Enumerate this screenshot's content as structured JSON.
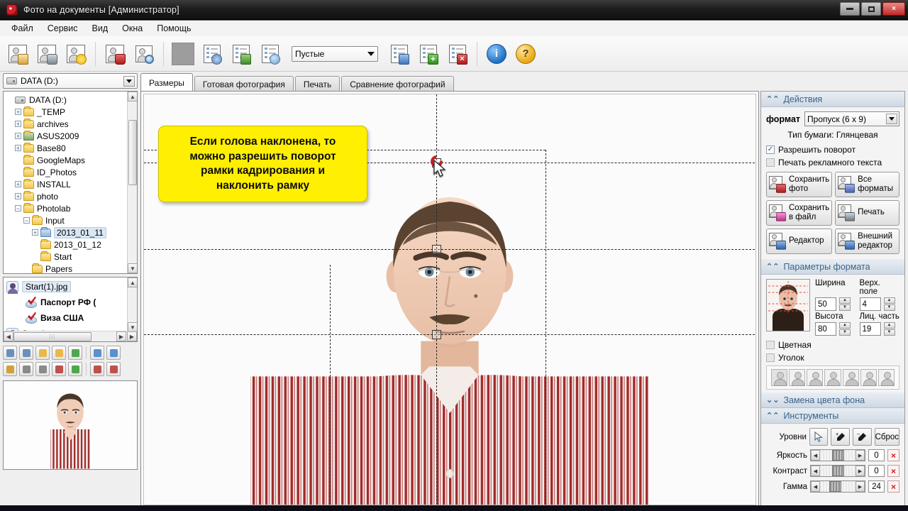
{
  "window": {
    "title": "Фото на документы  [Администратор]",
    "icon": "camera-icon",
    "controls": {
      "minimize": "minimize-icon",
      "maximize": "maximize-icon",
      "close": "×"
    }
  },
  "menu": {
    "items": [
      "Файл",
      "Сервис",
      "Вид",
      "Окна",
      "Помощь"
    ]
  },
  "toolbar": {
    "buttons": [
      {
        "name": "open-photo-button",
        "icon": "person-folder-icon"
      },
      {
        "name": "capture-photo-button",
        "icon": "person-camera-icon"
      },
      {
        "name": "new-photo-button",
        "icon": "person-star-icon"
      },
      {
        "name": "delete-photo-button",
        "icon": "person-trash-icon"
      },
      {
        "name": "find-photo-button",
        "icon": "person-search-icon"
      }
    ],
    "color_swatch": "#9d9d9d",
    "templates_combo": {
      "value": "Пустые",
      "placeholder": "Пустые"
    },
    "list_buttons": [
      {
        "name": "apply-template-button",
        "icon": "list-arrow-icon"
      },
      {
        "name": "add-template-button",
        "icon": "list-plus-icon"
      },
      {
        "name": "remove-template-button",
        "icon": "list-delete-icon"
      }
    ],
    "info_button": {
      "label": "i",
      "name": "info-button"
    },
    "help_button": {
      "label": "?",
      "name": "help-button"
    }
  },
  "sidebar": {
    "drive_combo": {
      "value": "DATA (D:)"
    },
    "tree": [
      {
        "label": "DATA (D:)",
        "indent": 0,
        "expander": "",
        "icon": "drive-icon"
      },
      {
        "label": "_TEMP",
        "indent": 1,
        "expander": "+",
        "icon": "folder-icon"
      },
      {
        "label": "archives",
        "indent": 1,
        "expander": "+",
        "icon": "folder-icon"
      },
      {
        "label": "ASUS2009",
        "indent": 1,
        "expander": "+",
        "icon": "folder-shortcut-icon"
      },
      {
        "label": "Base80",
        "indent": 1,
        "expander": "+",
        "icon": "folder-icon"
      },
      {
        "label": "GoogleMaps",
        "indent": 1,
        "expander": "",
        "icon": "folder-icon"
      },
      {
        "label": "ID_Photos",
        "indent": 1,
        "expander": "",
        "icon": "folder-icon"
      },
      {
        "label": "INSTALL",
        "indent": 1,
        "expander": "+",
        "icon": "folder-icon"
      },
      {
        "label": "photo",
        "indent": 1,
        "expander": "+",
        "icon": "folder-icon"
      },
      {
        "label": "Photolab",
        "indent": 1,
        "expander": "−",
        "icon": "folder-icon"
      },
      {
        "label": "Input",
        "indent": 2,
        "expander": "−",
        "icon": "folder-icon"
      },
      {
        "label": "2013_01_11",
        "indent": 3,
        "expander": "+",
        "icon": "folder-open-icon",
        "selected": true
      },
      {
        "label": "2013_01_12",
        "indent": 3,
        "expander": "",
        "icon": "folder-icon"
      },
      {
        "label": "Start",
        "indent": 3,
        "expander": "",
        "icon": "folder-icon"
      },
      {
        "label": "Papers",
        "indent": 2,
        "expander": "",
        "icon": "folder-icon"
      }
    ],
    "files": [
      {
        "label": "Start(1).jpg",
        "icon": "person-photo-icon",
        "selected": true,
        "child": false
      },
      {
        "label": "Паспорт РФ (",
        "icon": "check-format-icon",
        "selected": false,
        "child": true
      },
      {
        "label": "Виза США",
        "icon": "check-format-icon",
        "selected": false,
        "child": true
      },
      {
        "label": "Start.jpg",
        "icon": "person-photo-icon",
        "selected": false,
        "child": false
      }
    ],
    "hscroll_grip": "⦙⦙⦙",
    "minitools_row1": [
      {
        "name": "add-format-button",
        "icon": "add-format-icon"
      },
      {
        "name": "remove-format-button",
        "icon": "remove-format-icon"
      },
      {
        "name": "open-folder-button",
        "icon": "folder-up-icon"
      },
      {
        "name": "folder-props-button",
        "icon": "folder-window-icon"
      },
      {
        "name": "refresh-folder-button",
        "icon": "refresh-icon"
      },
      {
        "name": "sort-name-asc-button",
        "icon": "sort-az-down-icon"
      },
      {
        "name": "sort-date-asc-button",
        "icon": "sort-date-down-icon"
      }
    ],
    "minitools_row2": [
      {
        "name": "edit-button",
        "icon": "pencil-icon"
      },
      {
        "name": "rotate-left-button",
        "icon": "rotate-left-icon"
      },
      {
        "name": "rotate-right-button",
        "icon": "rotate-right-icon"
      },
      {
        "name": "delete-file-button",
        "icon": "delete-file-icon"
      },
      {
        "name": "swap-button",
        "icon": "swap-icon"
      },
      {
        "name": "sort-name-desc-button",
        "icon": "sort-az-up-icon"
      },
      {
        "name": "sort-date-desc-button",
        "icon": "sort-date-up-icon"
      }
    ]
  },
  "tabs": [
    {
      "label": "Размеры",
      "active": true
    },
    {
      "label": "Готовая фотография",
      "active": false
    },
    {
      "label": "Печать",
      "active": false
    },
    {
      "label": "Сравнение фотографий",
      "active": false
    }
  ],
  "callout": {
    "lines": [
      "Если голова наклонена, то",
      "можно разрешить поворот",
      "рамки кадрирования и",
      "наклонить рамку"
    ],
    "background": "#ffef00",
    "text_color": "#0d0d0d"
  },
  "canvas": {
    "rotate_handle": "rotate-handle",
    "cursor": "arrow-cursor",
    "handle_color": "#cf1f22"
  },
  "right_panel": {
    "actions": {
      "title": "Действия",
      "format_label": "формат",
      "format_value": "Пропуск (6 x 9)",
      "paper_type_label": "Тип бумаги:",
      "paper_type_value": "Глянцевая",
      "allow_rotation": {
        "label": "Разрешить поворот",
        "checked": true
      },
      "print_ad_text": {
        "label": "Печать рекламного текста",
        "checked": false
      },
      "buttons": [
        {
          "label": "Сохранить\nфото",
          "name": "save-photo-button",
          "icon": "save-photo-icon"
        },
        {
          "label": "Все\nформаты",
          "name": "all-formats-button",
          "icon": "all-formats-icon"
        },
        {
          "label": "Сохранить\nв файл",
          "name": "save-to-file-button",
          "icon": "save-file-icon"
        },
        {
          "label": "Печать",
          "name": "print-button",
          "icon": "printer-icon"
        },
        {
          "label": "Редактор",
          "name": "editor-button",
          "icon": "editor-icon"
        },
        {
          "label": "Внешний\nредактор",
          "name": "external-editor-button",
          "icon": "external-editor-icon"
        }
      ]
    },
    "format_params": {
      "title": "Параметры формата",
      "fields": [
        {
          "label": "Ширина",
          "value": "50",
          "name": "width-field"
        },
        {
          "label": "Верх. поле",
          "value": "4",
          "name": "top-margin-field"
        },
        {
          "label": "Высота",
          "value": "80",
          "name": "height-field"
        },
        {
          "label": "Лиц. часть",
          "value": "19",
          "name": "face-part-field"
        }
      ],
      "color_checkbox": {
        "label": "Цветная",
        "checked": false
      },
      "corner_checkbox": {
        "label": "Уголок",
        "checked": false
      },
      "pose_count": 7
    },
    "background_replace": {
      "title": "Замена цвета фона",
      "collapsed": true
    },
    "tools": {
      "title": "Инструменты",
      "levels_label": "Уровни",
      "reset_label": "Сброс",
      "level_buttons": [
        {
          "name": "pointer-tool-button",
          "icon": "pointer-icon"
        },
        {
          "name": "white-point-picker-button",
          "icon": "eyedropper-plus-icon"
        },
        {
          "name": "black-point-picker-button",
          "icon": "eyedropper-icon"
        }
      ],
      "sliders": [
        {
          "label": "Яркость",
          "value": "0",
          "pos": 50,
          "name": "brightness-slider"
        },
        {
          "label": "Контраст",
          "value": "0",
          "pos": 50,
          "name": "contrast-slider"
        },
        {
          "label": "Гамма",
          "value": "24",
          "pos": 42,
          "name": "gamma-slider"
        }
      ],
      "clear_icon": "×"
    }
  }
}
